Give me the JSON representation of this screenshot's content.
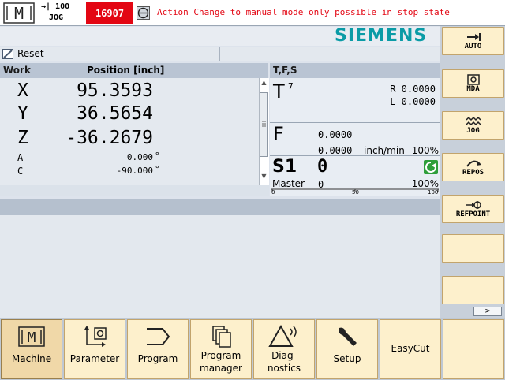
{
  "status": {
    "mode_symbol": "M",
    "override_icon": "→|",
    "override_value": "100",
    "mode": "JOG",
    "alarm_number": "16907",
    "alarm_text": "Action Change to manual mode only possible in stop state"
  },
  "brand": "SIEMENS",
  "channel": {
    "reset_label": "Reset"
  },
  "axes": {
    "header_work": "Work",
    "header_position": "Position [inch]",
    "rows": [
      {
        "name": "X",
        "value": "95.3593",
        "unit": ""
      },
      {
        "name": "Y",
        "value": "36.5654",
        "unit": ""
      },
      {
        "name": "Z",
        "value": "-36.2679",
        "unit": ""
      },
      {
        "name": "A",
        "value": "0.000",
        "unit": "°"
      },
      {
        "name": "C",
        "value": "-90.000",
        "unit": "°"
      }
    ]
  },
  "tfs": {
    "header": "T,F,S",
    "tool_letter": "T",
    "tool_number": "7",
    "r_value": "R 0.0000",
    "l_value": "L 0.0000",
    "feed_letter": "F",
    "feed_programmed": "0.0000",
    "feed_actual": "0.0000",
    "feed_unit": "inch/min",
    "feed_override": "100%",
    "spindle_letter": "S1",
    "spindle_speed": "0",
    "spindle_master": "Master",
    "spindle_value": "0",
    "spindle_override": "100%",
    "scale_ticks": [
      "0",
      "50",
      "100"
    ]
  },
  "vertical_softkeys": [
    {
      "label": "AUTO",
      "icon": "auto-arrow-icon"
    },
    {
      "label": "MDA",
      "icon": "mda-icon"
    },
    {
      "label": "JOG",
      "icon": "jog-wave-icon"
    },
    {
      "label": "REPOS",
      "icon": "repos-icon"
    },
    {
      "label": "REFPOINT",
      "icon": "refpoint-icon"
    },
    {
      "label": "",
      "icon": ""
    },
    {
      "label": "",
      "icon": ""
    },
    {
      "label": "",
      "icon": ""
    }
  ],
  "more_arrow": ">",
  "horizontal_softkeys": [
    {
      "label": "Machine",
      "icon": "machine-icon",
      "active": true
    },
    {
      "label": "Parameter",
      "icon": "parameter-icon",
      "active": false
    },
    {
      "label": "Program",
      "icon": "program-icon",
      "active": false
    },
    {
      "label": "Program\nmanager",
      "icon": "program-manager-icon",
      "active": false
    },
    {
      "label": "Diag-\nnostics",
      "icon": "diagnostics-icon",
      "active": false
    },
    {
      "label": "Setup",
      "icon": "wrench-icon",
      "active": false
    },
    {
      "label": "EasyCut",
      "icon": "",
      "active": false
    },
    {
      "label": "",
      "icon": "",
      "active": false
    }
  ],
  "colors": {
    "alarm_red": "#e30613",
    "brand_teal": "#0a9ba6",
    "softkey_bg": "#fdf0cc",
    "spindle_green": "#2e9e3a"
  }
}
